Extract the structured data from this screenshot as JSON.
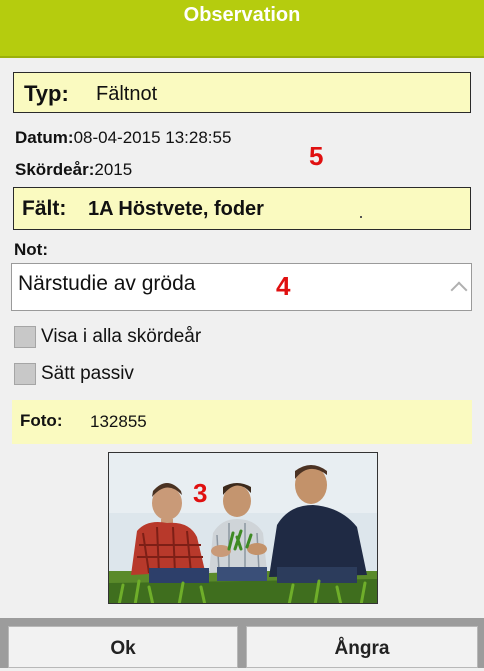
{
  "header": {
    "title": "Observation"
  },
  "typ": {
    "label": "Typ:",
    "value": "Fältnot"
  },
  "datum": {
    "label": "Datum:",
    "value": "08-04-2015 13:28:55"
  },
  "skordear": {
    "label": "Skördeår:",
    "value": "2015"
  },
  "falt": {
    "label": "Fält:",
    "value": "1A Höstvete, foder"
  },
  "note": {
    "label": "Not:",
    "value": "Närstudie av gröda"
  },
  "checkboxes": [
    {
      "label": "Visa i alla skördeår"
    },
    {
      "label": "Sätt passiv"
    }
  ],
  "foto": {
    "label": "Foto:",
    "value": "132855"
  },
  "annotations": {
    "a5": "5",
    "a4": "4",
    "a3": "3"
  },
  "buttons": {
    "ok": "Ok",
    "angra": "Ångra"
  },
  "colors": {
    "header": "#b5cc0e",
    "field_bg": "#fafac0",
    "annotation": "#e01010"
  }
}
